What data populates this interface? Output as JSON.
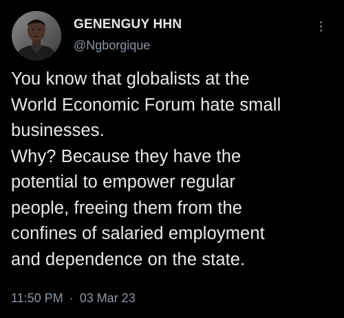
{
  "author": {
    "display_name": "GENENGUY HHN",
    "handle": "@Ngborgique"
  },
  "icons": {
    "more": "more-options-icon",
    "avatar": "profile-photo"
  },
  "tweet": {
    "text": "You know that globalists at the\nWorld Economic Forum hate small\nbusinesses.\nWhy? Because they have the\npotential to empower regular\npeople, freeing them from the\nconfines of salaried employment\nand dependence on the state.",
    "time": "11:50 PM",
    "separator": "·",
    "date": "03 Mar 23"
  },
  "colors": {
    "background": "#000000",
    "primary_text": "#e7e9ea",
    "secondary_text": "#8b98a5"
  }
}
